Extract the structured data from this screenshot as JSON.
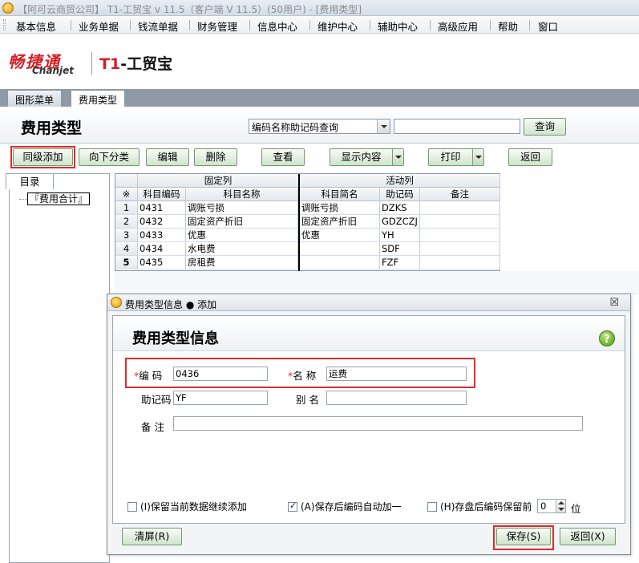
{
  "window": {
    "title": "【阿可云商贸公司】 T1-工贸宝 v 11.5（客户端 V 11.5）(50用户) - [费用类型]"
  },
  "menu": [
    "基本信息",
    "业务单据",
    "钱流单据",
    "财务管理",
    "信息中心",
    "维护中心",
    "辅助中心",
    "高级应用",
    "帮助",
    "窗口"
  ],
  "logo": {
    "brand_cn": "畅捷通",
    "brand_en": "Chanjet",
    "product_prefix": "T1",
    "product_name": "-工贸宝"
  },
  "tabs": [
    "图形菜单",
    "费用类型"
  ],
  "page": {
    "title": "费用类型",
    "search_select_value": "编码名称助记码查询",
    "search_input_value": "",
    "query_button": "查询"
  },
  "toolbar": {
    "sibling_add": "同级添加",
    "add_child": "向下分类",
    "edit": "编辑",
    "delete": "删除",
    "view": "查看",
    "display_content": "显示内容",
    "print": "打印",
    "back": "返回"
  },
  "tree": {
    "tab_label": "目录",
    "root_node": "『费用合计』"
  },
  "grid": {
    "group_fixed": "固定列",
    "group_active": "活动列",
    "row_marker": "※",
    "columns": [
      "科目编码",
      "科目名称",
      "科目简名",
      "助记码",
      "备注"
    ],
    "rows": [
      {
        "num": "1",
        "code": "0431",
        "name": "调账亏损",
        "short": "调账亏损",
        "mnemonic": "DZKS",
        "note": ""
      },
      {
        "num": "2",
        "code": "0432",
        "name": "固定资产折旧",
        "short": "固定资产折旧",
        "mnemonic": "GDZCZJ",
        "note": ""
      },
      {
        "num": "3",
        "code": "0433",
        "name": "优惠",
        "short": "优惠",
        "mnemonic": "YH",
        "note": ""
      },
      {
        "num": "4",
        "code": "0434",
        "name": "水电费",
        "short": "",
        "mnemonic": "SDF",
        "note": ""
      },
      {
        "num": "5",
        "code": "0435",
        "name": "房租费",
        "short": "",
        "mnemonic": "FZF",
        "note": ""
      }
    ]
  },
  "dialog": {
    "window_title": "费用类型信息 ● 添加",
    "close_glyph": "☒",
    "heading": "费用类型信息",
    "help_glyph": "?",
    "required_mark": "*",
    "code_label": "编  码",
    "code_value": "0436",
    "name_label": "名  称",
    "name_value": "运费",
    "mnemonic_label": "助记码",
    "mnemonic_value": "YF",
    "alias_label": "别  名",
    "alias_value": "",
    "note_label": "备  注",
    "note_value": "",
    "keep_data_label": "(I)保留当前数据继续添加",
    "auto_increment_label": "(A)保存后编码自动加一",
    "keep_prefix_label": "(H)存盘后编码保留前",
    "keep_prefix_value": "0",
    "keep_prefix_unit": "位",
    "clear_button": "清屏(R)",
    "save_button": "保存(S)",
    "back_button": "返回(X)"
  }
}
